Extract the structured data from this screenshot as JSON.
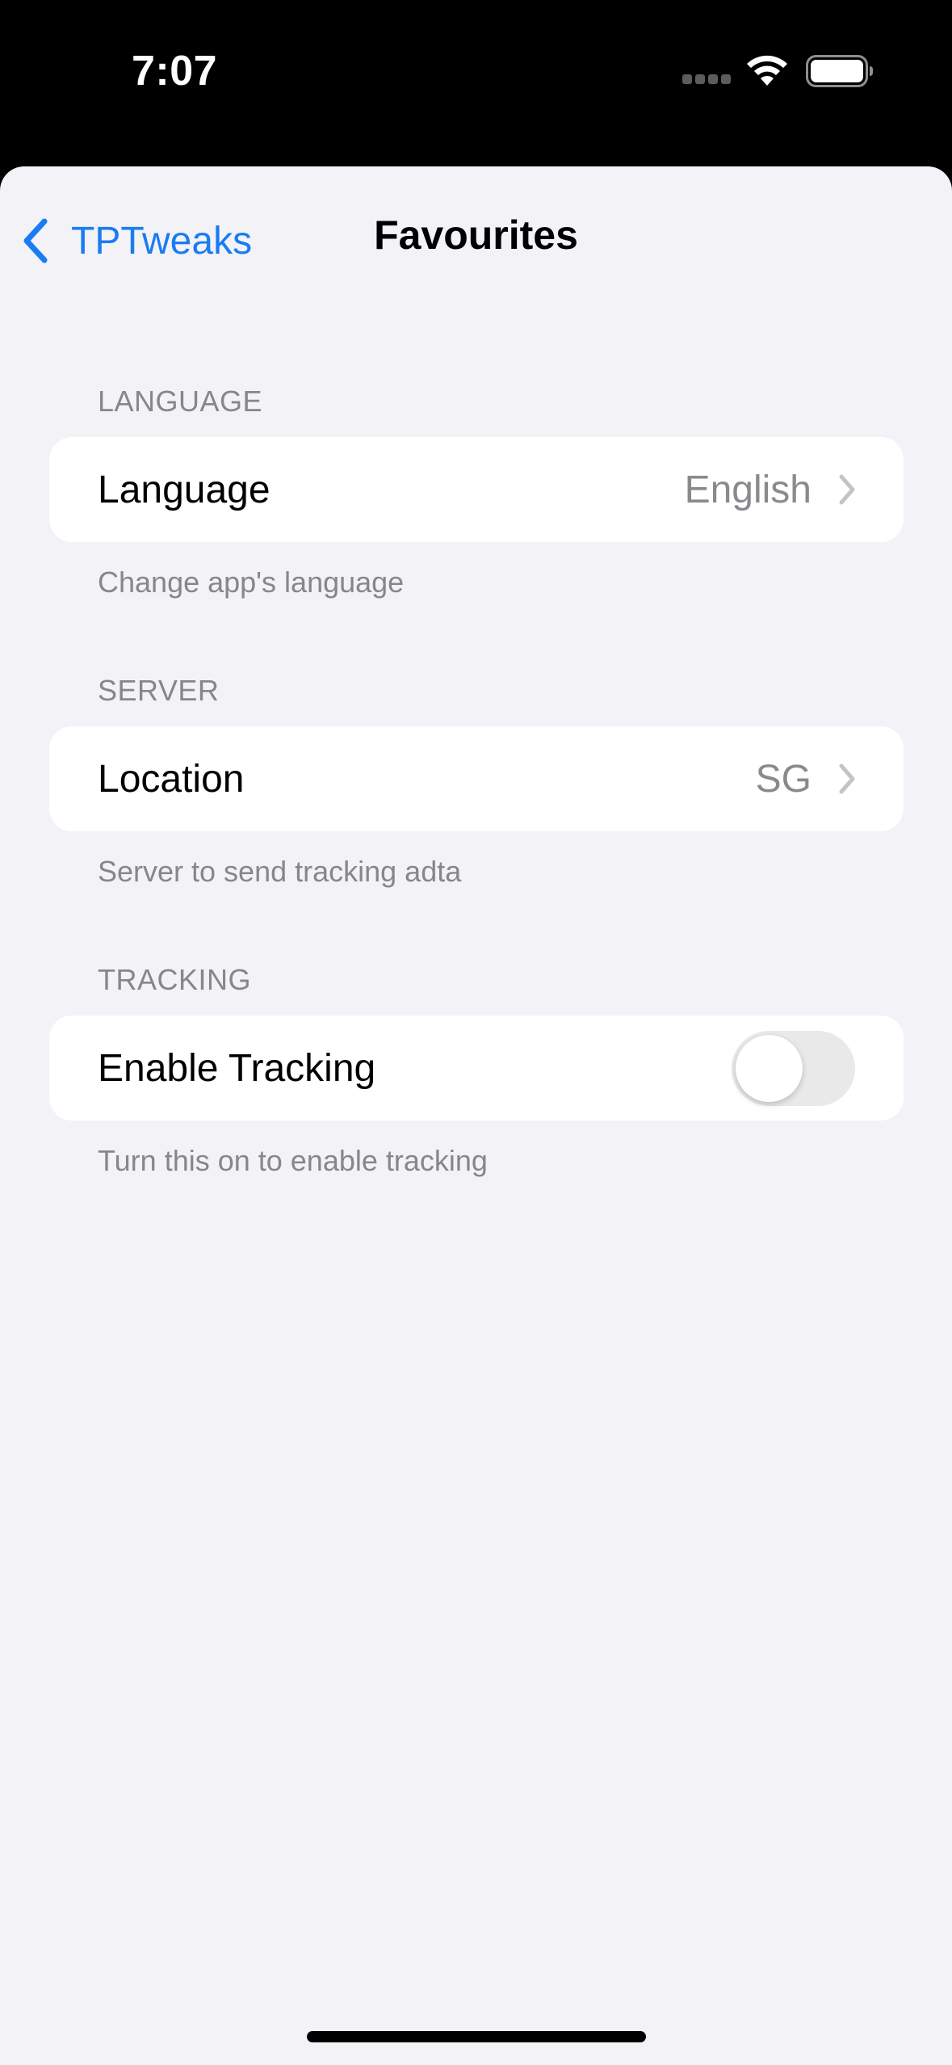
{
  "status_bar": {
    "time": "7:07",
    "icons": [
      "signal-icon",
      "wifi-icon",
      "battery-icon"
    ]
  },
  "nav": {
    "back_label": "TPTweaks",
    "title": "Favourites"
  },
  "sections": {
    "language": {
      "header": "LANGUAGE",
      "row_title": "Language",
      "row_value": "English",
      "footer": "Change app's language"
    },
    "server": {
      "header": "SERVER",
      "row_title": "Location",
      "row_value": "SG",
      "footer": "Server to send tracking adta"
    },
    "tracking": {
      "header": "TRACKING",
      "row_title": "Enable Tracking",
      "toggle_on": false,
      "footer": "Turn this on to enable tracking"
    }
  },
  "colors": {
    "accent": "#1a7cf2",
    "background": "#f2f2f7",
    "secondary_text": "#86868b",
    "toggle_off": "#e9e9ea"
  }
}
